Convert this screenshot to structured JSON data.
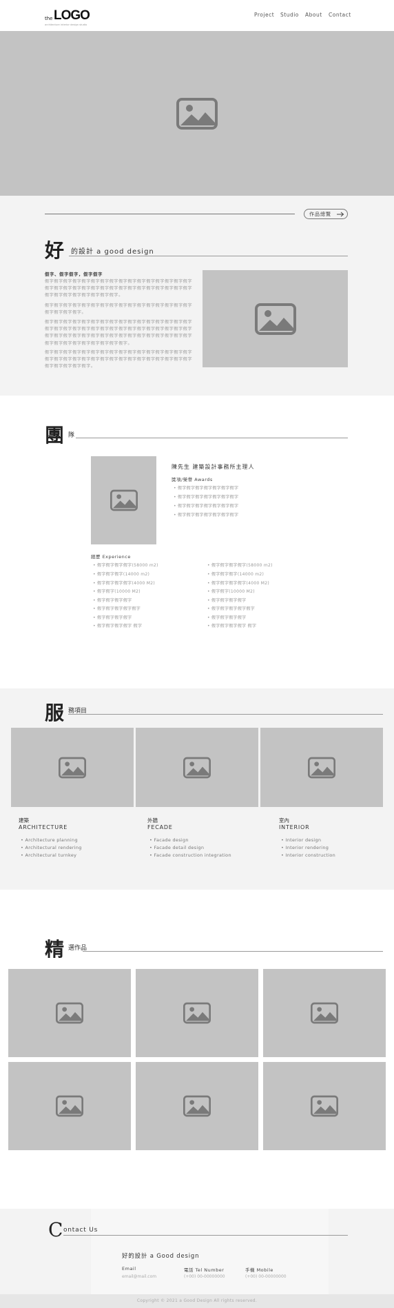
{
  "header": {
    "logo_the": "the",
    "logo_main": "LOGO",
    "logo_sub": "architecture interior design studio",
    "nav": [
      "Project",
      "Studio",
      "About",
      "Contact"
    ]
  },
  "intro": {
    "more_button": "作品總覽",
    "big_char": "好",
    "title": "的設計 a good design",
    "subtitle": "假字、假字假字，假字假字",
    "paragraphs": [
      "假字假字假字假字假字假字假字假字假字假字假字假字假字假字假字假字假字假字假字假字假字假字假字假字假字假字假字假字假字假字假字假字假字假字假字假字假字假字假字假字。",
      "假字假字假字假字假字假字假字假字假字假字假字假字假字假字假字假字假字假字假字假字。",
      "假字假字假字假字假字假字假字假字假字假字假字假字假字假字假字假字假字假字假字假字假字假字假字假字假字假字假字假字假字假字假字假字假字假字假字假字假字假字假字假字假字假字假字假字假字假字假字假字假字假字假字假字假字假字假字假字假字。",
      "假字假字假字假字假字假字假字假字假字假字假字假字假字假字假字假字假字假字假字假字假字假字假字假字假字假字假字假字假字假字假字假字假字假字假字假字假字。"
    ]
  },
  "team": {
    "big_char": "團",
    "title": "隊",
    "name": "陳先生  建築設計事務所主理人",
    "awards_title": "獎項/榮譽  Awards",
    "awards": [
      "假字假字假字假字假字假字假字",
      "假字假字假字假字假字假字假字",
      "假字假字假字假字假字假字假字",
      "假字假字假字假字假字假字假字"
    ],
    "experience_title": "經歷  Experience",
    "exp_left": [
      "假字假字假字假字(58000 m2)",
      "假字假字假字(14000 m2)",
      "假字假字假字假字(4000 M2)",
      "假字假字(10000 M2)",
      "假字假字假字假字",
      "假字假字假字假字假字",
      "假字假字假字假字",
      "假字假字假字假字 假字"
    ],
    "exp_right": [
      "假字假字假字假字(58000 m2)",
      "假字假字假字(14000 m2)",
      "假字假字假字假字(4000 M2)",
      "假字假字(10000 M2)",
      "假字假字假字假字",
      "假字假字假字假字假字",
      "假字假字假字假字",
      "假字假字假字假字 假字"
    ]
  },
  "services": {
    "big_char": "服",
    "title": "務項目",
    "columns": [
      {
        "zh": "建築",
        "en": "ARCHITECTURE",
        "items": [
          "Architecture planning",
          "Architectural rendering",
          "Architectural turnkey"
        ]
      },
      {
        "zh": "外牆",
        "en": "FECADE",
        "items": [
          "Facade design",
          "Facade detail design",
          "Facade construction integration"
        ]
      },
      {
        "zh": "室內",
        "en": "INTERIOR",
        "items": [
          "Interior design",
          "Interior rendering",
          "Interior construction"
        ]
      }
    ]
  },
  "works": {
    "big_char": "精",
    "title": "選作品"
  },
  "contact": {
    "big_char": "C",
    "title": "ontact Us",
    "company": "好的設計 a Good design",
    "email_label": "Email",
    "email_value": "email@mail.com",
    "tel_label": "電話 Tel Number",
    "tel_value": "(+00) 00-00000000",
    "mobile_label": "手機 Mobile",
    "mobile_value": "(+00) 00-00000000"
  },
  "footer": {
    "copyright": "Copyright © 2021 a Good Design All rights reserved."
  },
  "colors": {
    "placeholder": "#c3c3c3",
    "placeholder_icon": "#7a7a7a",
    "section_grey": "#f3f3f3",
    "footer_bar": "#e6e6e6"
  }
}
